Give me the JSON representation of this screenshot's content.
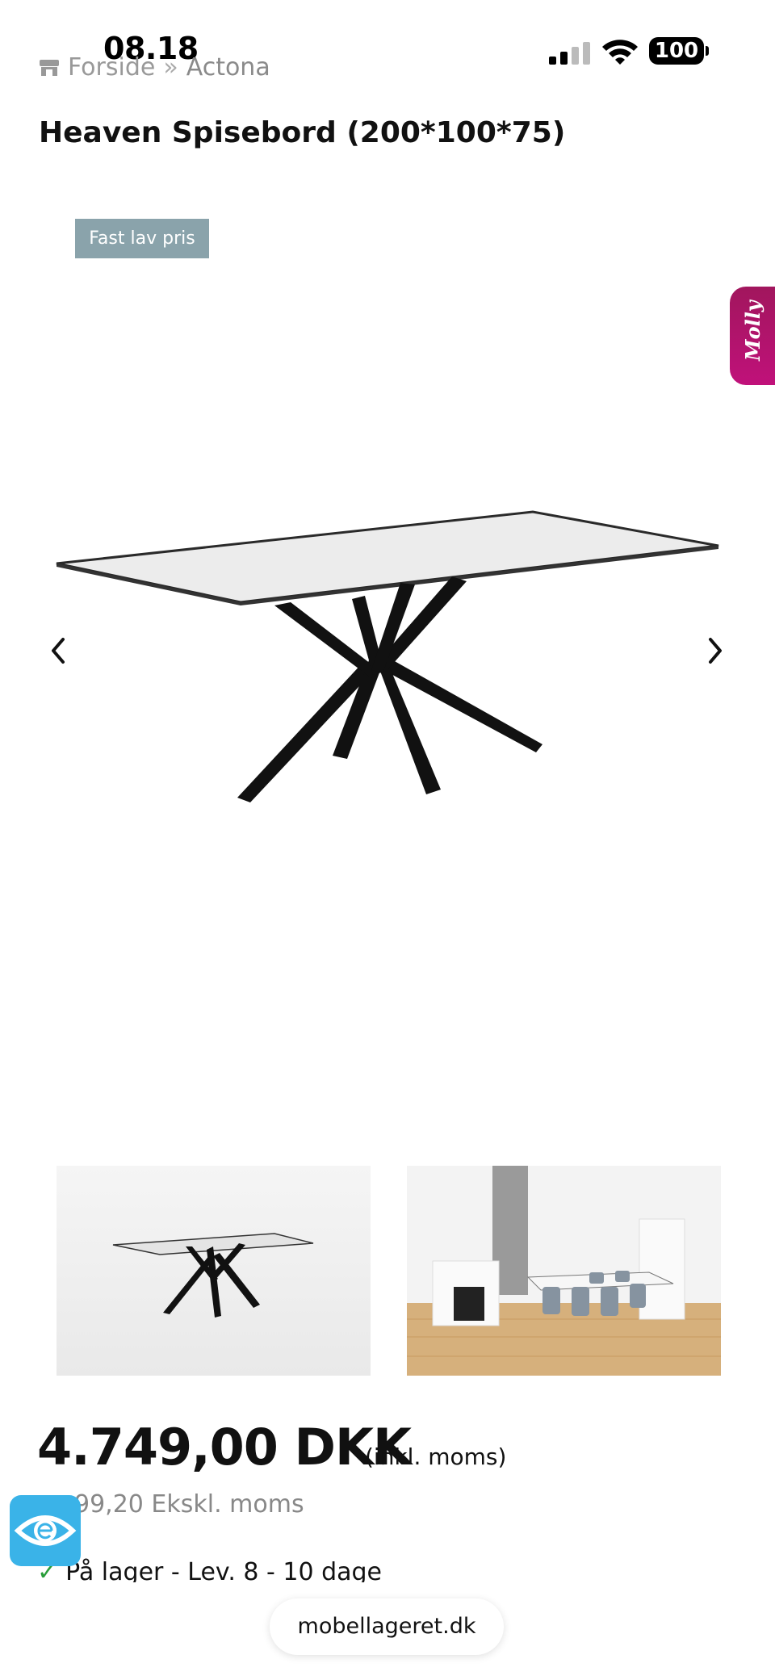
{
  "status_bar": {
    "time": "08.18",
    "battery": "100"
  },
  "breadcrumb": {
    "home": "Forside",
    "separator": "»",
    "current": "Actona"
  },
  "product": {
    "title": "Heaven Spisebord (200*100*75)",
    "badge": "Fast lav pris",
    "price": "4.749,00 DKK",
    "price_note": "(inkl. moms)",
    "price_excl": "99,20 Ekskl. moms",
    "stock": "På lager - Lev. 8 - 10 dage",
    "gallery_count": 2
  },
  "chat_widget": {
    "label": "Molly"
  },
  "browser": {
    "url": "mobellageret.dk"
  },
  "colors": {
    "badge": "#8aa3ab",
    "molly": "#b0146b",
    "accessibility": "#3ab3e8",
    "stock_check": "#2a9d3a"
  },
  "icons": {
    "home": "store-icon",
    "prev": "chevron-left-icon",
    "next": "chevron-right-icon",
    "accessibility": "eye-icon"
  }
}
